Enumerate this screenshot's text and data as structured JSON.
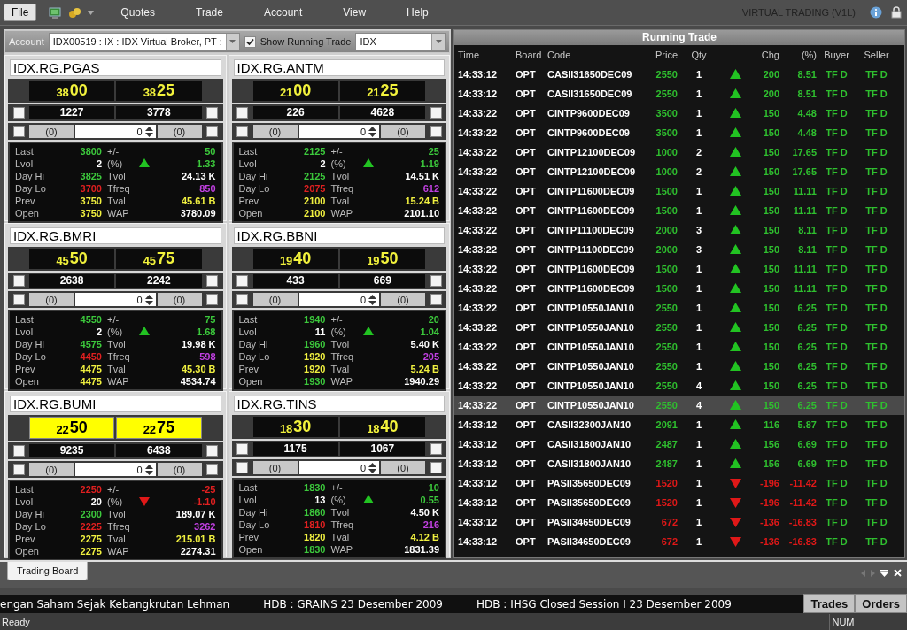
{
  "menu": {
    "items": [
      {
        "label": "File",
        "selected": true
      },
      {
        "label": "Quotes",
        "selected": false
      },
      {
        "label": "Trade",
        "selected": false
      },
      {
        "label": "Account",
        "selected": false
      },
      {
        "label": "View",
        "selected": false
      },
      {
        "label": "Help",
        "selected": false
      }
    ],
    "app_title": "VIRTUAL TRADING (V1L)"
  },
  "toolbar": {
    "account_label": "Account",
    "account": "IDX00519 : IX : IDX Virtual Broker, PT :",
    "show_running_trade": {
      "label": "Show Running Trade",
      "checked": true
    },
    "market": "IDX"
  },
  "boards": [
    {
      "code": "IDX.RG.PGAS",
      "flash": false,
      "bid": {
        "lead": "38",
        "tail": "00"
      },
      "offer": {
        "lead": "38",
        "tail": "25"
      },
      "bid_volume": "1227",
      "offer_volume": "3778",
      "bid_order": "(0)",
      "quantity": "0",
      "offer_order": "(0)",
      "options": [
        {
          "checked": false
        },
        {
          "checked": false
        },
        {
          "checked": false
        },
        {
          "checked": false
        }
      ],
      "rising": true,
      "stats": [
        {
          "label": "Last",
          "value": "3800",
          "color": "#3cc83c"
        },
        {
          "label": "+/-",
          "value": "50",
          "color": "#3cc83c"
        },
        {
          "label": "Lvol",
          "value": "2",
          "color": "#ffffff"
        },
        {
          "label": "(%)",
          "value": "1.33",
          "color": "#3cc83c"
        },
        {
          "label": "Day Hi",
          "value": "3825",
          "color": "#3cc83c"
        },
        {
          "label": "Tvol",
          "value": "24.13 K",
          "color": "#ffffff"
        },
        {
          "label": "Day Lo",
          "value": "3700",
          "color": "#e02020"
        },
        {
          "label": "Tfreq",
          "value": "850",
          "color": "#c040e0"
        },
        {
          "label": "Prev",
          "value": "3750",
          "color": "#f0f040"
        },
        {
          "label": "Tval",
          "value": "45.61 B",
          "color": "#f0f040"
        },
        {
          "label": "Open",
          "value": "3750",
          "color": "#f0f040"
        },
        {
          "label": "WAP",
          "value": "3780.09",
          "color": "#ffffff"
        }
      ]
    },
    {
      "code": "IDX.RG.ANTM",
      "flash": false,
      "bid": {
        "lead": "21",
        "tail": "00"
      },
      "offer": {
        "lead": "21",
        "tail": "25"
      },
      "bid_volume": "226",
      "offer_volume": "4628",
      "bid_order": "(0)",
      "quantity": "0",
      "offer_order": "(0)",
      "options": [
        {
          "checked": false
        },
        {
          "checked": false
        },
        {
          "checked": false
        },
        {
          "checked": false
        }
      ],
      "rising": true,
      "stats": [
        {
          "label": "Last",
          "value": "2125",
          "color": "#3cc83c"
        },
        {
          "label": "+/-",
          "value": "25",
          "color": "#3cc83c"
        },
        {
          "label": "Lvol",
          "value": "2",
          "color": "#ffffff"
        },
        {
          "label": "(%)",
          "value": "1.19",
          "color": "#3cc83c"
        },
        {
          "label": "Day Hi",
          "value": "2125",
          "color": "#3cc83c"
        },
        {
          "label": "Tvol",
          "value": "14.51 K",
          "color": "#ffffff"
        },
        {
          "label": "Day Lo",
          "value": "2075",
          "color": "#e02020"
        },
        {
          "label": "Tfreq",
          "value": "612",
          "color": "#c040e0"
        },
        {
          "label": "Prev",
          "value": "2100",
          "color": "#f0f040"
        },
        {
          "label": "Tval",
          "value": "15.24 B",
          "color": "#f0f040"
        },
        {
          "label": "Open",
          "value": "2100",
          "color": "#f0f040"
        },
        {
          "label": "WAP",
          "value": "2101.10",
          "color": "#ffffff"
        }
      ]
    },
    {
      "code": "IDX.RG.BMRI",
      "flash": false,
      "bid": {
        "lead": "45",
        "tail": "50"
      },
      "offer": {
        "lead": "45",
        "tail": "75"
      },
      "bid_volume": "2638",
      "offer_volume": "2242",
      "bid_order": "(0)",
      "quantity": "0",
      "offer_order": "(0)",
      "options": [
        {
          "checked": false
        },
        {
          "checked": false
        },
        {
          "checked": false
        },
        {
          "checked": false
        }
      ],
      "rising": true,
      "stats": [
        {
          "label": "Last",
          "value": "4550",
          "color": "#3cc83c"
        },
        {
          "label": "+/-",
          "value": "75",
          "color": "#3cc83c"
        },
        {
          "label": "Lvol",
          "value": "2",
          "color": "#ffffff"
        },
        {
          "label": "(%)",
          "value": "1.68",
          "color": "#3cc83c"
        },
        {
          "label": "Day Hi",
          "value": "4575",
          "color": "#3cc83c"
        },
        {
          "label": "Tvol",
          "value": "19.98 K",
          "color": "#ffffff"
        },
        {
          "label": "Day Lo",
          "value": "4450",
          "color": "#e02020"
        },
        {
          "label": "Tfreq",
          "value": "598",
          "color": "#c040e0"
        },
        {
          "label": "Prev",
          "value": "4475",
          "color": "#f0f040"
        },
        {
          "label": "Tval",
          "value": "45.30 B",
          "color": "#f0f040"
        },
        {
          "label": "Open",
          "value": "4475",
          "color": "#f0f040"
        },
        {
          "label": "WAP",
          "value": "4534.74",
          "color": "#ffffff"
        }
      ]
    },
    {
      "code": "IDX.RG.BBNI",
      "flash": false,
      "bid": {
        "lead": "19",
        "tail": "40"
      },
      "offer": {
        "lead": "19",
        "tail": "50"
      },
      "bid_volume": "433",
      "offer_volume": "669",
      "bid_order": "(0)",
      "quantity": "0",
      "offer_order": "(0)",
      "options": [
        {
          "checked": false
        },
        {
          "checked": false
        },
        {
          "checked": false
        },
        {
          "checked": false
        }
      ],
      "rising": true,
      "stats": [
        {
          "label": "Last",
          "value": "1940",
          "color": "#3cc83c"
        },
        {
          "label": "+/-",
          "value": "20",
          "color": "#3cc83c"
        },
        {
          "label": "Lvol",
          "value": "11",
          "color": "#ffffff"
        },
        {
          "label": "(%)",
          "value": "1.04",
          "color": "#3cc83c"
        },
        {
          "label": "Day Hi",
          "value": "1960",
          "color": "#3cc83c"
        },
        {
          "label": "Tvol",
          "value": "5.40 K",
          "color": "#ffffff"
        },
        {
          "label": "Day Lo",
          "value": "1920",
          "color": "#f0f040"
        },
        {
          "label": "Tfreq",
          "value": "205",
          "color": "#c040e0"
        },
        {
          "label": "Prev",
          "value": "1920",
          "color": "#f0f040"
        },
        {
          "label": "Tval",
          "value": "5.24 B",
          "color": "#f0f040"
        },
        {
          "label": "Open",
          "value": "1930",
          "color": "#3cc83c"
        },
        {
          "label": "WAP",
          "value": "1940.29",
          "color": "#ffffff"
        }
      ]
    },
    {
      "code": "IDX.RG.BUMI",
      "flash": true,
      "bid": {
        "lead": "22",
        "tail": "50"
      },
      "offer": {
        "lead": "22",
        "tail": "75"
      },
      "bid_volume": "9235",
      "offer_volume": "6438",
      "bid_order": "(0)",
      "quantity": "0",
      "offer_order": "(0)",
      "options": [
        {
          "checked": false
        },
        {
          "checked": false
        },
        {
          "checked": false
        },
        {
          "checked": false
        }
      ],
      "rising": false,
      "stats": [
        {
          "label": "Last",
          "value": "2250",
          "color": "#e02020"
        },
        {
          "label": "+/-",
          "value": "-25",
          "color": "#e02020"
        },
        {
          "label": "Lvol",
          "value": "20",
          "color": "#ffffff"
        },
        {
          "label": "(%)",
          "value": "-1.10",
          "color": "#e02020"
        },
        {
          "label": "Day Hi",
          "value": "2300",
          "color": "#3cc83c"
        },
        {
          "label": "Tvol",
          "value": "189.07 K",
          "color": "#ffffff"
        },
        {
          "label": "Day Lo",
          "value": "2225",
          "color": "#e02020"
        },
        {
          "label": "Tfreq",
          "value": "3262",
          "color": "#c040e0"
        },
        {
          "label": "Prev",
          "value": "2275",
          "color": "#f0f040"
        },
        {
          "label": "Tval",
          "value": "215.01 B",
          "color": "#f0f040"
        },
        {
          "label": "Open",
          "value": "2275",
          "color": "#f0f040"
        },
        {
          "label": "WAP",
          "value": "2274.31",
          "color": "#ffffff"
        }
      ]
    },
    {
      "code": "IDX.RG.TINS",
      "flash": false,
      "bid": {
        "lead": "18",
        "tail": "30"
      },
      "offer": {
        "lead": "18",
        "tail": "40"
      },
      "bid_volume": "1175",
      "offer_volume": "1067",
      "bid_order": "(0)",
      "quantity": "0",
      "offer_order": "(0)",
      "options": [
        {
          "checked": false
        },
        {
          "checked": false
        },
        {
          "checked": false
        },
        {
          "checked": false
        }
      ],
      "rising": true,
      "stats": [
        {
          "label": "Last",
          "value": "1830",
          "color": "#3cc83c"
        },
        {
          "label": "+/-",
          "value": "10",
          "color": "#3cc83c"
        },
        {
          "label": "Lvol",
          "value": "13",
          "color": "#ffffff"
        },
        {
          "label": "(%)",
          "value": "0.55",
          "color": "#3cc83c"
        },
        {
          "label": "Day Hi",
          "value": "1860",
          "color": "#3cc83c"
        },
        {
          "label": "Tvol",
          "value": "4.50 K",
          "color": "#ffffff"
        },
        {
          "label": "Day Lo",
          "value": "1810",
          "color": "#e02020"
        },
        {
          "label": "Tfreq",
          "value": "216",
          "color": "#c040e0"
        },
        {
          "label": "Prev",
          "value": "1820",
          "color": "#f0f040"
        },
        {
          "label": "Tval",
          "value": "4.12 B",
          "color": "#f0f040"
        },
        {
          "label": "Open",
          "value": "1830",
          "color": "#3cc83c"
        },
        {
          "label": "WAP",
          "value": "1831.39",
          "color": "#ffffff"
        }
      ]
    }
  ],
  "running_trade": {
    "title": "Running Trade",
    "columns": [
      "Time",
      "Board",
      "Code",
      "Price",
      "Qty",
      "Chg",
      "(%)",
      "Buyer",
      "Seller"
    ],
    "rows": [
      {
        "time": "14:33:12",
        "board": "OPT",
        "code": "CASII31650DEC09",
        "price": "2550",
        "qty": "1",
        "rising": true,
        "chg": "200",
        "pct": "8.51",
        "buyer": "TF D",
        "seller": "TF D",
        "selected": false
      },
      {
        "time": "14:33:12",
        "board": "OPT",
        "code": "CASII31650DEC09",
        "price": "2550",
        "qty": "1",
        "rising": true,
        "chg": "200",
        "pct": "8.51",
        "buyer": "TF D",
        "seller": "TF D",
        "selected": false
      },
      {
        "time": "14:33:22",
        "board": "OPT",
        "code": "CINTP9600DEC09",
        "price": "3500",
        "qty": "1",
        "rising": true,
        "chg": "150",
        "pct": "4.48",
        "buyer": "TF D",
        "seller": "TF D",
        "selected": false
      },
      {
        "time": "14:33:22",
        "board": "OPT",
        "code": "CINTP9600DEC09",
        "price": "3500",
        "qty": "1",
        "rising": true,
        "chg": "150",
        "pct": "4.48",
        "buyer": "TF D",
        "seller": "TF D",
        "selected": false
      },
      {
        "time": "14:33:22",
        "board": "OPT",
        "code": "CINTP12100DEC09",
        "price": "1000",
        "qty": "2",
        "rising": true,
        "chg": "150",
        "pct": "17.65",
        "buyer": "TF D",
        "seller": "TF D",
        "selected": false
      },
      {
        "time": "14:33:22",
        "board": "OPT",
        "code": "CINTP12100DEC09",
        "price": "1000",
        "qty": "2",
        "rising": true,
        "chg": "150",
        "pct": "17.65",
        "buyer": "TF D",
        "seller": "TF D",
        "selected": false
      },
      {
        "time": "14:33:22",
        "board": "OPT",
        "code": "CINTP11600DEC09",
        "price": "1500",
        "qty": "1",
        "rising": true,
        "chg": "150",
        "pct": "11.11",
        "buyer": "TF D",
        "seller": "TF D",
        "selected": false
      },
      {
        "time": "14:33:22",
        "board": "OPT",
        "code": "CINTP11600DEC09",
        "price": "1500",
        "qty": "1",
        "rising": true,
        "chg": "150",
        "pct": "11.11",
        "buyer": "TF D",
        "seller": "TF D",
        "selected": false
      },
      {
        "time": "14:33:22",
        "board": "OPT",
        "code": "CINTP11100DEC09",
        "price": "2000",
        "qty": "3",
        "rising": true,
        "chg": "150",
        "pct": "8.11",
        "buyer": "TF D",
        "seller": "TF D",
        "selected": false
      },
      {
        "time": "14:33:22",
        "board": "OPT",
        "code": "CINTP11100DEC09",
        "price": "2000",
        "qty": "3",
        "rising": true,
        "chg": "150",
        "pct": "8.11",
        "buyer": "TF D",
        "seller": "TF D",
        "selected": false
      },
      {
        "time": "14:33:22",
        "board": "OPT",
        "code": "CINTP11600DEC09",
        "price": "1500",
        "qty": "1",
        "rising": true,
        "chg": "150",
        "pct": "11.11",
        "buyer": "TF D",
        "seller": "TF D",
        "selected": false
      },
      {
        "time": "14:33:22",
        "board": "OPT",
        "code": "CINTP11600DEC09",
        "price": "1500",
        "qty": "1",
        "rising": true,
        "chg": "150",
        "pct": "11.11",
        "buyer": "TF D",
        "seller": "TF D",
        "selected": false
      },
      {
        "time": "14:33:22",
        "board": "OPT",
        "code": "CINTP10550JAN10",
        "price": "2550",
        "qty": "1",
        "rising": true,
        "chg": "150",
        "pct": "6.25",
        "buyer": "TF D",
        "seller": "TF D",
        "selected": false
      },
      {
        "time": "14:33:22",
        "board": "OPT",
        "code": "CINTP10550JAN10",
        "price": "2550",
        "qty": "1",
        "rising": true,
        "chg": "150",
        "pct": "6.25",
        "buyer": "TF D",
        "seller": "TF D",
        "selected": false
      },
      {
        "time": "14:33:22",
        "board": "OPT",
        "code": "CINTP10550JAN10",
        "price": "2550",
        "qty": "1",
        "rising": true,
        "chg": "150",
        "pct": "6.25",
        "buyer": "TF D",
        "seller": "TF D",
        "selected": false
      },
      {
        "time": "14:33:22",
        "board": "OPT",
        "code": "CINTP10550JAN10",
        "price": "2550",
        "qty": "1",
        "rising": true,
        "chg": "150",
        "pct": "6.25",
        "buyer": "TF D",
        "seller": "TF D",
        "selected": false
      },
      {
        "time": "14:33:22",
        "board": "OPT",
        "code": "CINTP10550JAN10",
        "price": "2550",
        "qty": "4",
        "rising": true,
        "chg": "150",
        "pct": "6.25",
        "buyer": "TF D",
        "seller": "TF D",
        "selected": false
      },
      {
        "time": "14:33:22",
        "board": "OPT",
        "code": "CINTP10550JAN10",
        "price": "2550",
        "qty": "4",
        "rising": true,
        "chg": "150",
        "pct": "6.25",
        "buyer": "TF D",
        "seller": "TF D",
        "selected": true
      },
      {
        "time": "14:33:12",
        "board": "OPT",
        "code": "CASII32300JAN10",
        "price": "2091",
        "qty": "1",
        "rising": true,
        "chg": "116",
        "pct": "5.87",
        "buyer": "TF D",
        "seller": "TF D",
        "selected": false
      },
      {
        "time": "14:33:12",
        "board": "OPT",
        "code": "CASII31800JAN10",
        "price": "2487",
        "qty": "1",
        "rising": true,
        "chg": "156",
        "pct": "6.69",
        "buyer": "TF D",
        "seller": "TF D",
        "selected": false
      },
      {
        "time": "14:33:12",
        "board": "OPT",
        "code": "CASII31800JAN10",
        "price": "2487",
        "qty": "1",
        "rising": true,
        "chg": "156",
        "pct": "6.69",
        "buyer": "TF D",
        "seller": "TF D",
        "selected": false
      },
      {
        "time": "14:33:12",
        "board": "OPT",
        "code": "PASII35650DEC09",
        "price": "1520",
        "qty": "1",
        "rising": false,
        "chg": "-196",
        "pct": "-11.42",
        "buyer": "TF D",
        "seller": "TF D",
        "selected": false
      },
      {
        "time": "14:33:12",
        "board": "OPT",
        "code": "PASII35650DEC09",
        "price": "1520",
        "qty": "1",
        "rising": false,
        "chg": "-196",
        "pct": "-11.42",
        "buyer": "TF D",
        "seller": "TF D",
        "selected": false
      },
      {
        "time": "14:33:12",
        "board": "OPT",
        "code": "PASII34650DEC09",
        "price": "672",
        "qty": "1",
        "rising": false,
        "chg": "-136",
        "pct": "-16.83",
        "buyer": "TF D",
        "seller": "TF D",
        "selected": false
      },
      {
        "time": "14:33:12",
        "board": "OPT",
        "code": "PASII34650DEC09",
        "price": "672",
        "qty": "1",
        "rising": false,
        "chg": "-136",
        "pct": "-16.83",
        "buyer": "TF D",
        "seller": "TF D",
        "selected": false
      }
    ]
  },
  "tabs": [
    {
      "label": "Trading Board",
      "selected": true
    }
  ],
  "ticker": [
    "engan Saham Sejak Kebangkrutan Lehman",
    "HDB : GRAINS 23 Desember 2009",
    "HDB : IHSG Closed Session I 23 Desember 2009"
  ],
  "ticker_buttons": [
    "Trades",
    "Orders"
  ],
  "status_bar": {
    "message": "Ready",
    "indicator": "NUM"
  }
}
